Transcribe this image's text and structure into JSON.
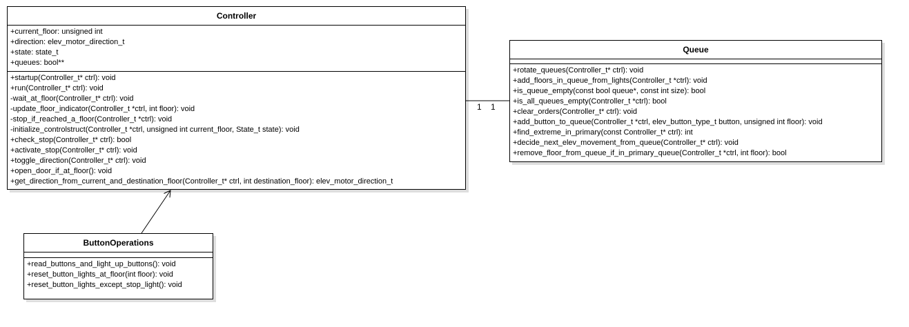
{
  "colors": {
    "line": "#000000",
    "background": "#ffffff",
    "shadow": "#dddddd"
  },
  "classes": {
    "controller": {
      "name": "Controller",
      "attributes": [
        "+current_floor: unsigned int",
        "+direction: elev_motor_direction_t",
        "+state: state_t",
        "+queues: bool**"
      ],
      "methods": [
        "+startup(Controller_t* ctrl): void",
        "+run(Controller_t* ctrl): void",
        "-wait_at_floor(Controller_t* ctrl): void",
        "-update_floor_indicator(Controller_t *ctrl, int floor): void",
        "-stop_if_reached_a_floor(Controller_t *ctrl): void",
        "-initialize_controlstruct(Controller_t *ctrl, unsigned int current_floor, State_t state): void",
        "+check_stop(Controller_t* ctrl): bool",
        "+activate_stop(Controller_t* ctrl): void",
        "+toggle_direction(Controller_t* ctrl): void",
        "+open_door_if_at_floor(): void",
        "+get_direction_from_current_and_destination_floor(Controller_t* ctrl, int destination_floor): elev_motor_direction_t"
      ]
    },
    "queue": {
      "name": "Queue",
      "attributes": [],
      "methods": [
        "+rotate_queues(Controller_t* ctrl): void",
        "+add_floors_in_queue_from_lights(Controller_t *ctrl): void",
        "+is_queue_empty(const bool queue*, const int size): bool",
        "+is_all_queues_empty(Controller_t *ctrl): bool",
        "+clear_orders(Controller_t* ctrl): void",
        "+add_button_to_queue(Controller_t *ctrl, elev_button_type_t button, unsigned int floor): void",
        "+find_extreme_in_primary(const Controller_t* ctrl): int",
        "+decide_next_elev_movement_from_queue(Controller_t* ctrl): void",
        "+remove_floor_from_queue_if_in_primary_queue(Controller_t *ctrl, int floor): bool"
      ]
    },
    "buttonops": {
      "name": "ButtonOperations",
      "attributes": [],
      "methods": [
        "+read_buttons_and_light_up_buttons(): void",
        "+reset_button_lights_at_floor(int floor): void",
        "+reset_button_lights_except_stop_light(): void"
      ]
    }
  },
  "associations": {
    "controller_queue": {
      "multiplicity_controller": "1",
      "multiplicity_queue": "1"
    }
  }
}
